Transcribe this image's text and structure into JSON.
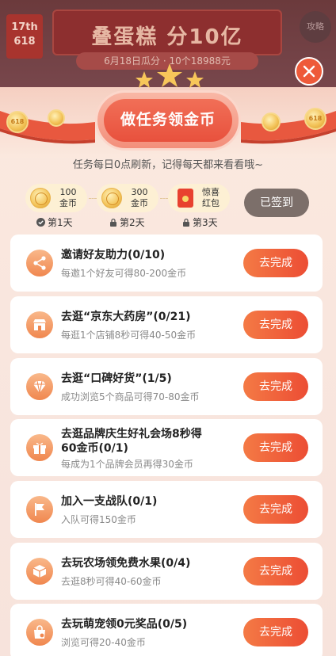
{
  "background": {
    "badge_line1": "17th",
    "badge_line2": "618",
    "banner_title": "叠蛋糕 分10亿",
    "banner_sub": "6月18日瓜分 · 10个18988元",
    "right_button": "攻略"
  },
  "header": {
    "title": "做任务领金币",
    "subtitle": "任务每日0点刷新，记得每天都来看看哦~"
  },
  "checkin": {
    "days": [
      {
        "amount": "100",
        "unit": "金币",
        "label": "第1天",
        "status": "checked"
      },
      {
        "amount": "300",
        "unit": "金币",
        "label": "第2天",
        "status": "locked"
      },
      {
        "amount": "惊喜",
        "unit": "红包",
        "label": "第3天",
        "status": "locked"
      }
    ],
    "button": "已签到"
  },
  "tasks": [
    {
      "icon": "share-icon",
      "title": "邀请好友助力(0/10)",
      "desc": "每邀1个好友可得80-200金币",
      "button": "去完成"
    },
    {
      "icon": "store-icon",
      "title": "去逛“京东大药房”(0/21)",
      "desc": "每逛1个店铺8秒可得40-50金币",
      "button": "去完成"
    },
    {
      "icon": "diamond-icon",
      "title": "去逛“口碑好货”(1/5)",
      "desc": "成功浏览5个商品可得70-80金币",
      "button": "去完成"
    },
    {
      "icon": "gift-icon",
      "title_line1": "去逛品牌庆生好礼会场8秒得",
      "title_line2": "60金币(0/1)",
      "desc": "每成为1个品牌会员再得30金币",
      "button": "去完成"
    },
    {
      "icon": "flag-icon",
      "title": "加入一支战队(0/1)",
      "desc": "入队可得150金币",
      "button": "去完成"
    },
    {
      "icon": "box-icon",
      "title": "去玩农场领免费水果(0/4)",
      "desc": "去逛8秒可得40-60金币",
      "button": "去完成"
    },
    {
      "icon": "pet-bag-icon",
      "title": "去玩萌宠领0元奖品(0/5)",
      "desc": "浏览可得20-40金币",
      "button": "去完成"
    }
  ],
  "colors": {
    "accent": "#ec4d34",
    "panel": "#fbe9df",
    "signed": "#7c6f6a"
  }
}
